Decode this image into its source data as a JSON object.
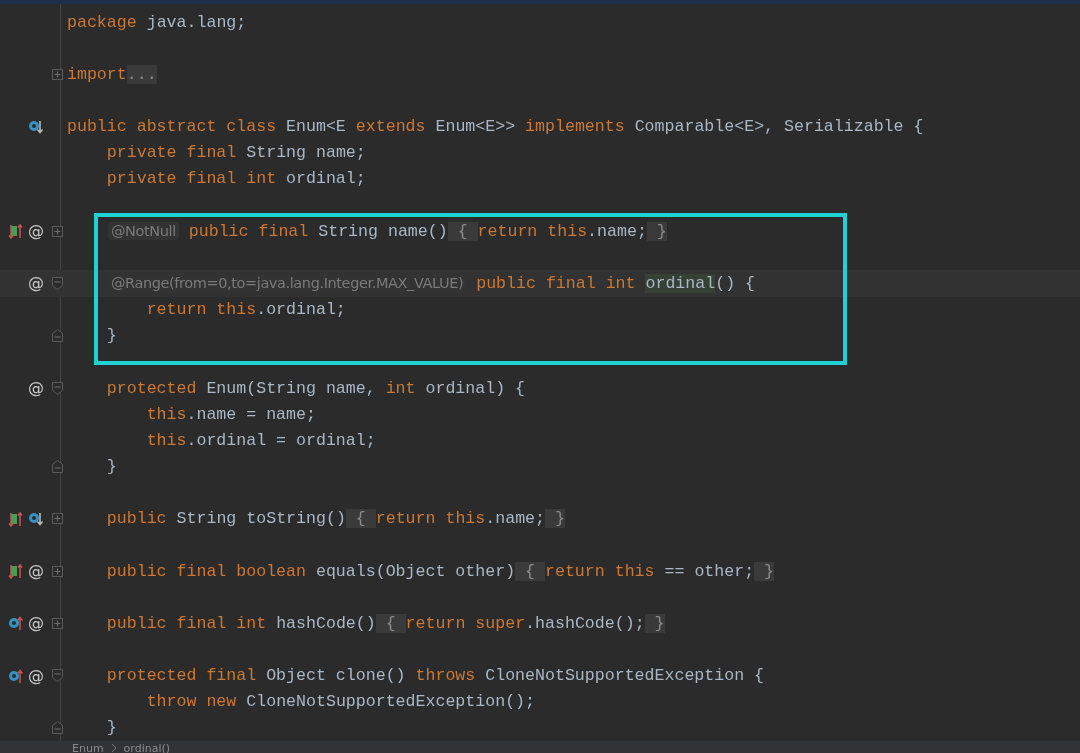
{
  "editor": {
    "lines": [
      {
        "segments": [
          {
            "kind": "code",
            "tokens": [
              {
                "text": "package",
                "kind": "keyword"
              },
              {
                "text": " java.lang;",
                "kind": "plain"
              }
            ]
          }
        ]
      },
      {
        "gap_before": true,
        "fold": {
          "kind": "collapsed"
        },
        "segments": [
          {
            "kind": "code",
            "tokens": [
              {
                "text": "import",
                "kind": "keyword"
              }
            ]
          },
          {
            "kind": "fold",
            "text": "..."
          }
        ]
      },
      {
        "gap_before": true,
        "markers": [
          {
            "kind": "implemented"
          }
        ],
        "segments": [
          {
            "kind": "code",
            "tokens": [
              {
                "text": "public abstract class",
                "kind": "keyword"
              },
              {
                "text": " Enum<E ",
                "kind": "plain"
              },
              {
                "text": "extends",
                "kind": "keyword"
              },
              {
                "text": " Enum<E>> ",
                "kind": "plain"
              },
              {
                "text": "implements",
                "kind": "keyword"
              },
              {
                "text": " Comparable<E>, Serializable {",
                "kind": "plain"
              }
            ]
          }
        ]
      },
      {
        "segments": [
          {
            "kind": "code",
            "tokens": [
              {
                "text": "    private final",
                "kind": "keyword"
              },
              {
                "text": " String name;",
                "kind": "plain"
              }
            ]
          }
        ]
      },
      {
        "segments": [
          {
            "kind": "code",
            "tokens": [
              {
                "text": "    private final int",
                "kind": "keyword"
              },
              {
                "text": " ordinal;",
                "kind": "plain"
              }
            ]
          }
        ]
      },
      {
        "gap_before": true,
        "markers": [
          {
            "kind": "overrides"
          },
          {
            "kind": "annotation",
            "text": "@"
          }
        ],
        "fold": {
          "kind": "collapsed"
        },
        "indented": true,
        "segments": [
          {
            "kind": "inlay",
            "text": "@NotNull"
          },
          {
            "kind": "code",
            "tokens": [
              {
                "text": " public final",
                "kind": "keyword"
              },
              {
                "text": " String name()",
                "kind": "plain"
              }
            ]
          },
          {
            "kind": "fold",
            "text": " { "
          },
          {
            "kind": "code",
            "tokens": [
              {
                "text": "return this",
                "kind": "keyword"
              },
              {
                "text": ".name;",
                "kind": "plain"
              }
            ]
          },
          {
            "kind": "fold",
            "text": " }"
          }
        ]
      },
      {
        "gap_before": true,
        "markers": [
          {
            "kind": "annotation",
            "text": "@"
          }
        ],
        "fold": {
          "kind": "start"
        },
        "current": true,
        "indented": true,
        "segments": [
          {
            "kind": "inlay",
            "text": "@Range(from=0,to=java.lang.Integer.MAX_VALUE)"
          },
          {
            "kind": "code",
            "tokens": [
              {
                "text": " public final int ",
                "kind": "keyword"
              },
              {
                "text": "ordinal",
                "kind": "usage"
              },
              {
                "text": "() {",
                "kind": "plain"
              }
            ]
          }
        ]
      },
      {
        "segments": [
          {
            "kind": "code",
            "tokens": [
              {
                "text": "        return this",
                "kind": "keyword"
              },
              {
                "text": ".ordinal;",
                "kind": "plain"
              }
            ]
          }
        ]
      },
      {
        "fold": {
          "kind": "end"
        },
        "segments": [
          {
            "kind": "code",
            "tokens": [
              {
                "text": "    }",
                "kind": "plain"
              }
            ]
          }
        ]
      },
      {
        "gap_before": true,
        "markers": [
          {
            "kind": "annotation",
            "text": "@"
          }
        ],
        "fold": {
          "kind": "start"
        },
        "segments": [
          {
            "kind": "code",
            "tokens": [
              {
                "text": "    protected",
                "kind": "keyword"
              },
              {
                "text": " Enum(String name, ",
                "kind": "plain"
              },
              {
                "text": "int",
                "kind": "keyword"
              },
              {
                "text": " ordinal) {",
                "kind": "plain"
              }
            ]
          }
        ]
      },
      {
        "segments": [
          {
            "kind": "code",
            "tokens": [
              {
                "text": "        this",
                "kind": "keyword"
              },
              {
                "text": ".name = name;",
                "kind": "plain"
              }
            ]
          }
        ]
      },
      {
        "segments": [
          {
            "kind": "code",
            "tokens": [
              {
                "text": "        this",
                "kind": "keyword"
              },
              {
                "text": ".ordinal = ordinal;",
                "kind": "plain"
              }
            ]
          }
        ]
      },
      {
        "fold": {
          "kind": "end"
        },
        "segments": [
          {
            "kind": "code",
            "tokens": [
              {
                "text": "    }",
                "kind": "plain"
              }
            ]
          }
        ]
      },
      {
        "gap_before": true,
        "markers": [
          {
            "kind": "overrides"
          },
          {
            "kind": "implemented"
          }
        ],
        "fold": {
          "kind": "collapsed"
        },
        "segments": [
          {
            "kind": "code",
            "tokens": [
              {
                "text": "    public",
                "kind": "keyword"
              },
              {
                "text": " String toString()",
                "kind": "plain"
              }
            ]
          },
          {
            "kind": "fold",
            "text": " { "
          },
          {
            "kind": "code",
            "tokens": [
              {
                "text": "return this",
                "kind": "keyword"
              },
              {
                "text": ".name;",
                "kind": "plain"
              }
            ]
          },
          {
            "kind": "fold",
            "text": " }"
          }
        ]
      },
      {
        "gap_before": true,
        "markers": [
          {
            "kind": "overrides"
          },
          {
            "kind": "annotation",
            "text": "@"
          }
        ],
        "fold": {
          "kind": "collapsed"
        },
        "segments": [
          {
            "kind": "code",
            "tokens": [
              {
                "text": "    public final boolean",
                "kind": "keyword"
              },
              {
                "text": " equals(Object other)",
                "kind": "plain"
              }
            ]
          },
          {
            "kind": "fold",
            "text": " { "
          },
          {
            "kind": "code",
            "tokens": [
              {
                "text": "return this",
                "kind": "keyword"
              },
              {
                "text": " == other;",
                "kind": "plain"
              }
            ]
          },
          {
            "kind": "fold",
            "text": " }"
          }
        ]
      },
      {
        "gap_before": true,
        "markers": [
          {
            "kind": "overriding"
          },
          {
            "kind": "annotation",
            "text": "@"
          }
        ],
        "fold": {
          "kind": "collapsed"
        },
        "segments": [
          {
            "kind": "code",
            "tokens": [
              {
                "text": "    public final int",
                "kind": "keyword"
              },
              {
                "text": " hashCode()",
                "kind": "plain"
              }
            ]
          },
          {
            "kind": "fold",
            "text": " { "
          },
          {
            "kind": "code",
            "tokens": [
              {
                "text": "return super",
                "kind": "keyword"
              },
              {
                "text": ".hashCode();",
                "kind": "plain"
              }
            ]
          },
          {
            "kind": "fold",
            "text": " }"
          }
        ]
      },
      {
        "gap_before": true,
        "markers": [
          {
            "kind": "overriding"
          },
          {
            "kind": "annotation",
            "text": "@"
          }
        ],
        "fold": {
          "kind": "start"
        },
        "segments": [
          {
            "kind": "code",
            "tokens": [
              {
                "text": "    protected final",
                "kind": "keyword"
              },
              {
                "text": " Object clone() ",
                "kind": "plain"
              },
              {
                "text": "throws",
                "kind": "keyword"
              },
              {
                "text": " CloneNotSupportedException {",
                "kind": "plain"
              }
            ]
          }
        ]
      },
      {
        "segments": [
          {
            "kind": "code",
            "tokens": [
              {
                "text": "        throw new",
                "kind": "keyword"
              },
              {
                "text": " CloneNotSupportedException();",
                "kind": "plain"
              }
            ]
          }
        ]
      },
      {
        "fold": {
          "kind": "end"
        },
        "segments": [
          {
            "kind": "code",
            "tokens": [
              {
                "text": "    }",
                "kind": "plain"
              }
            ]
          }
        ]
      }
    ]
  },
  "breadcrumb": [
    "Enum",
    "ordinal()"
  ]
}
